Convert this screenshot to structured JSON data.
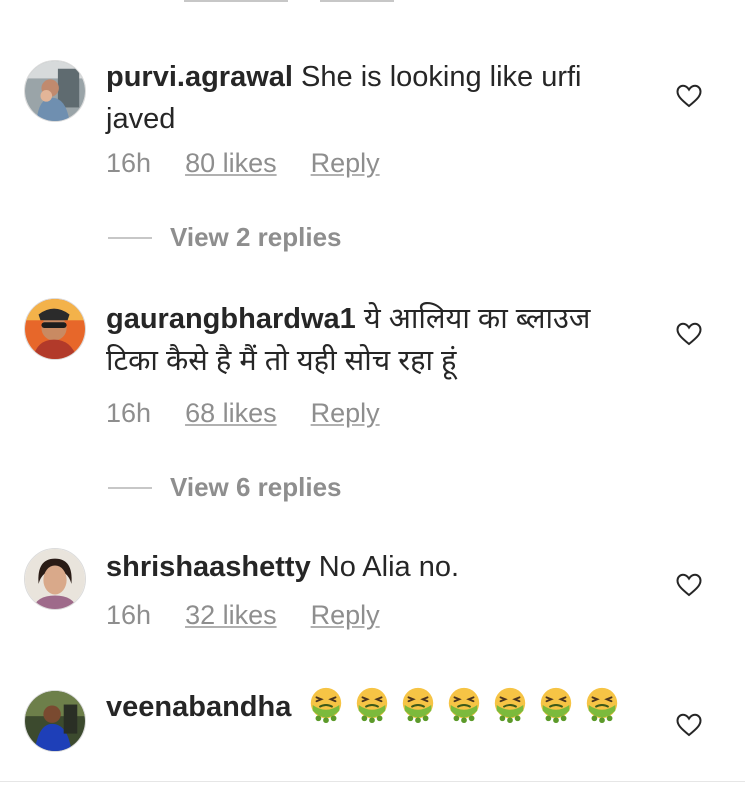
{
  "comments": [
    {
      "username": "purvi.agrawal",
      "text": "She is looking like urfi javed",
      "time": "16h",
      "likes": "80 likes",
      "reply": "Reply",
      "view_replies": "View 2 replies"
    },
    {
      "username": "gaurangbhardwa1",
      "text": "ये आलिया का ब्लाउज टिका कैसे है मैं तो यही सोच रहा हूं",
      "time": "16h",
      "likes": "68 likes",
      "reply": "Reply",
      "view_replies": "View 6 replies"
    },
    {
      "username": "shrishaashetty",
      "text": "No Alia no.",
      "time": "16h",
      "likes": "32 likes",
      "reply": "Reply"
    },
    {
      "username": "veenabandha",
      "text": "",
      "emoji": "nauseated-face",
      "emoji_count": 7
    }
  ],
  "icons": {
    "like": "heart-outline-icon",
    "reaction": "nauseated-face"
  },
  "colors": {
    "text": "#262626",
    "secondary": "#8e8e8e",
    "divider": "#c7c7c7"
  }
}
